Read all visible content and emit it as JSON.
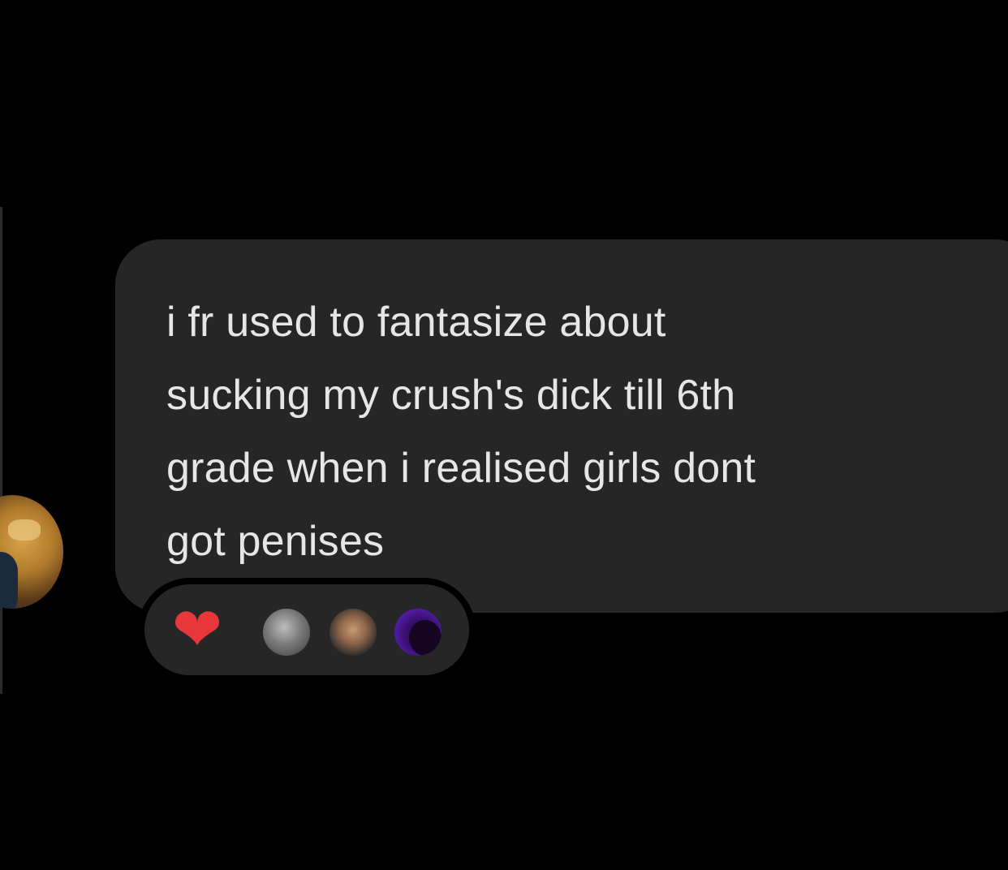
{
  "conversation": {
    "message": {
      "text": "i fr used to fantasize about\nsucking my crush's dick till 6th\ngrade when i realised girls dont\ngot penises"
    },
    "reactions": {
      "emoji": "❤",
      "emoji_name": "red-heart",
      "reactor_count_visible": 3
    }
  },
  "colors": {
    "background": "#000000",
    "bubble": "#262626",
    "text": "#e6e6e6",
    "heart": "#e8363b"
  }
}
